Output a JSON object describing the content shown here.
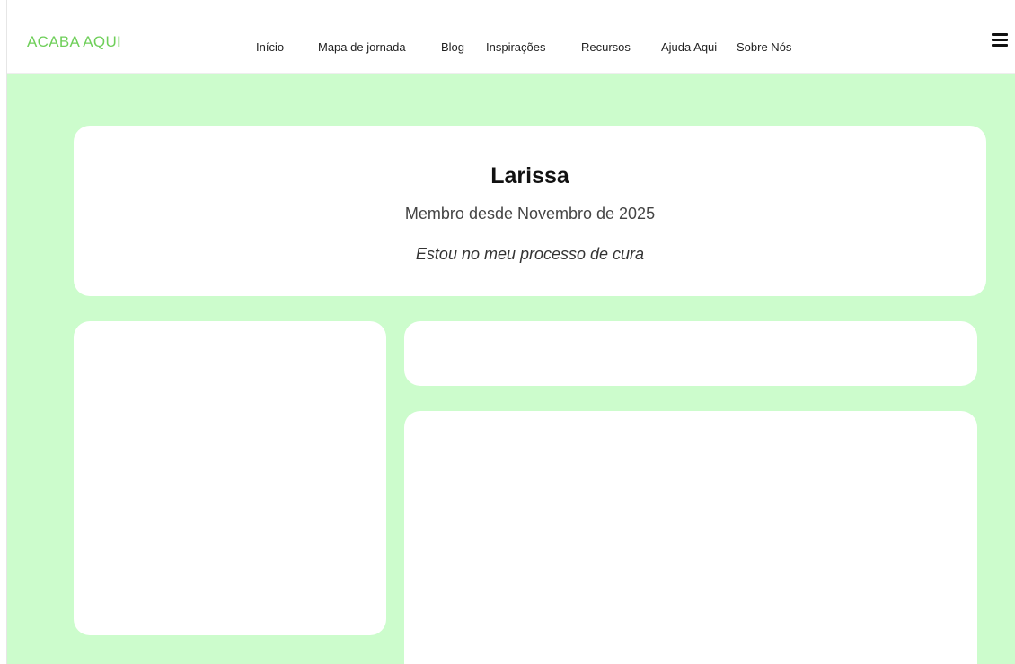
{
  "header": {
    "brand": "ACABA AQUI",
    "nav": [
      {
        "label": "Início"
      },
      {
        "label": "Mapa de jornada"
      },
      {
        "label": "Blog"
      },
      {
        "label": "Inspirações"
      },
      {
        "label": "Recursos"
      },
      {
        "label": "Ajuda Aqui"
      },
      {
        "label": "Sobre Nós"
      }
    ],
    "menu_icon": "hamburger-menu-icon"
  },
  "profile": {
    "name": "Larissa",
    "member_since": "Membro desde Novembro de 2025",
    "status": "Estou no meu processo de cura"
  },
  "colors": {
    "brand": "#6fcf5a",
    "background": "#ccfccc",
    "card": "#ffffff"
  }
}
